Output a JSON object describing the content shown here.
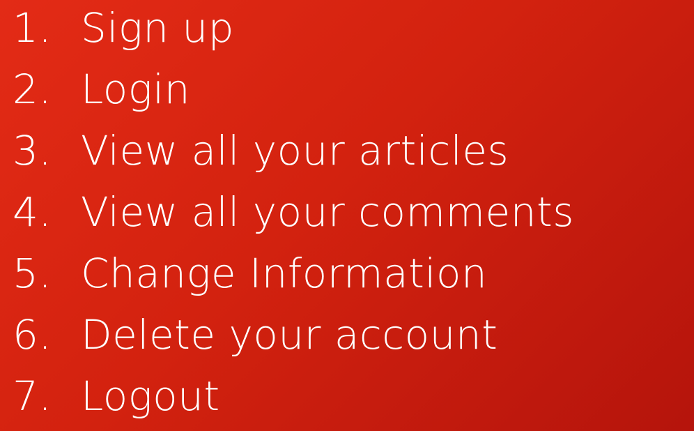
{
  "menu": {
    "items": [
      {
        "number": "1.",
        "label": "Sign up"
      },
      {
        "number": "2.",
        "label": "Login"
      },
      {
        "number": "3.",
        "label": "View all your articles"
      },
      {
        "number": "4.",
        "label": "View all your comments"
      },
      {
        "number": "5.",
        "label": "Change Information"
      },
      {
        "number": "6.",
        "label": "Delete your account"
      },
      {
        "number": "7.",
        "label": "Logout"
      }
    ]
  },
  "colors": {
    "background_top": "#e32b16",
    "background_bottom": "#b5140c",
    "text": "#ffffff"
  }
}
